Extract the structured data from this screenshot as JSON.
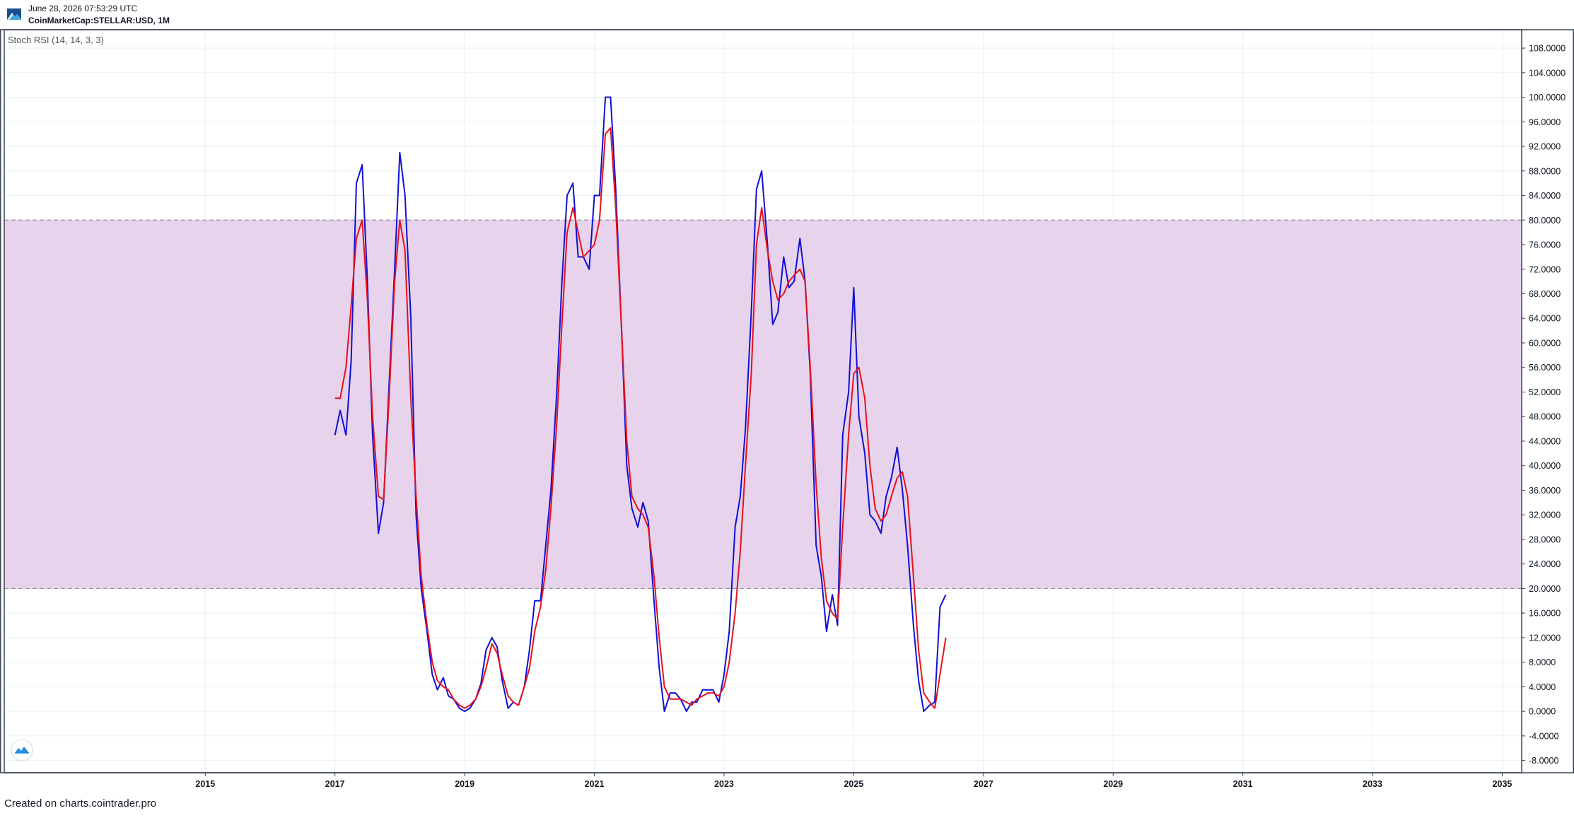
{
  "header": {
    "date": "June 28, 2026 07:53:29 UTC",
    "symbol": "CoinMarketCap:STELLAR:USD, 1M"
  },
  "footer": {
    "text": "Created on charts.cointrader.pro"
  },
  "colors": {
    "k_line": "#1010d8",
    "d_line": "#e8101c",
    "band_fill": "#e3cbe7",
    "band_border": "#9a8fa0",
    "grid": "#e9eff5",
    "frame": "#3b4552"
  },
  "chart_data": {
    "type": "line",
    "title": "Stoch RSI (14, 14, 3, 3)",
    "xlabel": "",
    "ylabel": "",
    "ylim": [
      -10,
      111
    ],
    "xlim": [
      2011.9,
      2035.3
    ],
    "grid": true,
    "legend": "none",
    "band": {
      "from": 20,
      "to": 80
    },
    "x_ticks": [
      "2015",
      "2017",
      "2019",
      "2021",
      "2023",
      "2025",
      "2027",
      "2029",
      "2031",
      "2033",
      "2035"
    ],
    "y_ticks": [
      "108.0000",
      "104.0000",
      "100.0000",
      "96.0000",
      "92.0000",
      "88.0000",
      "84.0000",
      "80.0000",
      "76.0000",
      "72.0000",
      "68.0000",
      "64.0000",
      "60.0000",
      "56.0000",
      "52.0000",
      "48.0000",
      "44.0000",
      "40.0000",
      "36.0000",
      "32.0000",
      "28.0000",
      "24.0000",
      "20.0000",
      "16.0000",
      "12.0000",
      "8.0000",
      "4.0000",
      "0.0000",
      "-4.0000",
      "-8.0000"
    ],
    "series": [
      {
        "values": [
          [
            2017.0,
            45
          ],
          [
            2017.08,
            49
          ],
          [
            2017.17,
            45
          ],
          [
            2017.25,
            57
          ],
          [
            2017.33,
            86
          ],
          [
            2017.42,
            89
          ],
          [
            2017.5,
            70
          ],
          [
            2017.58,
            45
          ],
          [
            2017.67,
            29
          ],
          [
            2017.75,
            34
          ],
          [
            2017.83,
            52
          ],
          [
            2017.92,
            72
          ],
          [
            2018.0,
            91
          ],
          [
            2018.08,
            84
          ],
          [
            2018.17,
            64
          ],
          [
            2018.25,
            32
          ],
          [
            2018.33,
            20
          ],
          [
            2018.42,
            13
          ],
          [
            2018.5,
            6
          ],
          [
            2018.58,
            3.5
          ],
          [
            2018.67,
            5.5
          ],
          [
            2018.75,
            2.5
          ],
          [
            2018.83,
            2
          ],
          [
            2018.92,
            0.5
          ],
          [
            2019.0,
            0
          ],
          [
            2019.08,
            0.5
          ],
          [
            2019.17,
            2
          ],
          [
            2019.25,
            4.5
          ],
          [
            2019.33,
            10
          ],
          [
            2019.42,
            12
          ],
          [
            2019.5,
            10.5
          ],
          [
            2019.58,
            5
          ],
          [
            2019.67,
            0.5
          ],
          [
            2019.75,
            1.5
          ],
          [
            2019.83,
            1
          ],
          [
            2019.92,
            4
          ],
          [
            2020.0,
            10
          ],
          [
            2020.08,
            18
          ],
          [
            2020.17,
            18
          ],
          [
            2020.25,
            27
          ],
          [
            2020.33,
            36
          ],
          [
            2020.42,
            52
          ],
          [
            2020.5,
            70
          ],
          [
            2020.58,
            84
          ],
          [
            2020.67,
            86
          ],
          [
            2020.75,
            74
          ],
          [
            2020.83,
            74
          ],
          [
            2020.92,
            72
          ],
          [
            2021.0,
            84
          ],
          [
            2021.08,
            84
          ],
          [
            2021.17,
            100
          ],
          [
            2021.25,
            100
          ],
          [
            2021.33,
            85
          ],
          [
            2021.42,
            62
          ],
          [
            2021.5,
            40
          ],
          [
            2021.58,
            33
          ],
          [
            2021.67,
            30
          ],
          [
            2021.75,
            34
          ],
          [
            2021.83,
            31
          ],
          [
            2021.92,
            18
          ],
          [
            2022.0,
            7
          ],
          [
            2022.08,
            0
          ],
          [
            2022.17,
            3
          ],
          [
            2022.25,
            3
          ],
          [
            2022.33,
            2
          ],
          [
            2022.42,
            0
          ],
          [
            2022.5,
            1.5
          ],
          [
            2022.58,
            1.5
          ],
          [
            2022.67,
            3.5
          ],
          [
            2022.75,
            3.5
          ],
          [
            2022.83,
            3.5
          ],
          [
            2022.92,
            1.5
          ],
          [
            2023.0,
            6
          ],
          [
            2023.08,
            13
          ],
          [
            2023.17,
            30
          ],
          [
            2023.25,
            35
          ],
          [
            2023.33,
            46
          ],
          [
            2023.42,
            65
          ],
          [
            2023.5,
            85
          ],
          [
            2023.58,
            88
          ],
          [
            2023.67,
            76
          ],
          [
            2023.75,
            63
          ],
          [
            2023.83,
            65
          ],
          [
            2023.92,
            74
          ],
          [
            2024.0,
            69
          ],
          [
            2024.08,
            70
          ],
          [
            2024.17,
            77
          ],
          [
            2024.25,
            70
          ],
          [
            2024.33,
            55
          ],
          [
            2024.42,
            27
          ],
          [
            2024.5,
            22
          ],
          [
            2024.58,
            13
          ],
          [
            2024.67,
            19
          ],
          [
            2024.75,
            14
          ],
          [
            2024.83,
            45
          ],
          [
            2024.92,
            52
          ],
          [
            2025.0,
            69
          ],
          [
            2025.08,
            48
          ],
          [
            2025.17,
            42
          ],
          [
            2025.25,
            32
          ],
          [
            2025.33,
            31
          ],
          [
            2025.42,
            29
          ],
          [
            2025.5,
            35
          ],
          [
            2025.58,
            38
          ],
          [
            2025.67,
            43
          ],
          [
            2025.75,
            36
          ],
          [
            2025.83,
            27
          ],
          [
            2025.92,
            14
          ],
          [
            2026.0,
            5
          ],
          [
            2026.08,
            0
          ],
          [
            2026.17,
            1
          ],
          [
            2026.25,
            1.5
          ],
          [
            2026.33,
            17
          ],
          [
            2026.42,
            19
          ]
        ]
      },
      {
        "values": [
          [
            2017.0,
            51
          ],
          [
            2017.08,
            51
          ],
          [
            2017.17,
            56
          ],
          [
            2017.25,
            66
          ],
          [
            2017.33,
            77
          ],
          [
            2017.42,
            80
          ],
          [
            2017.5,
            67
          ],
          [
            2017.58,
            48
          ],
          [
            2017.67,
            35
          ],
          [
            2017.75,
            34.5
          ],
          [
            2017.83,
            50
          ],
          [
            2017.92,
            70
          ],
          [
            2018.0,
            80
          ],
          [
            2018.08,
            75
          ],
          [
            2018.17,
            51
          ],
          [
            2018.25,
            35
          ],
          [
            2018.33,
            22
          ],
          [
            2018.42,
            14
          ],
          [
            2018.5,
            8
          ],
          [
            2018.58,
            5
          ],
          [
            2018.67,
            4
          ],
          [
            2018.75,
            3.5
          ],
          [
            2018.83,
            2
          ],
          [
            2018.92,
            1
          ],
          [
            2019.0,
            0.5
          ],
          [
            2019.08,
            1
          ],
          [
            2019.17,
            2
          ],
          [
            2019.25,
            4
          ],
          [
            2019.33,
            7
          ],
          [
            2019.42,
            11
          ],
          [
            2019.5,
            9.5
          ],
          [
            2019.58,
            6
          ],
          [
            2019.67,
            2.5
          ],
          [
            2019.75,
            1.5
          ],
          [
            2019.83,
            1
          ],
          [
            2019.92,
            4
          ],
          [
            2020.0,
            7
          ],
          [
            2020.08,
            13
          ],
          [
            2020.17,
            17
          ],
          [
            2020.25,
            23
          ],
          [
            2020.33,
            33
          ],
          [
            2020.42,
            47
          ],
          [
            2020.5,
            63
          ],
          [
            2020.58,
            78
          ],
          [
            2020.67,
            82
          ],
          [
            2020.75,
            78
          ],
          [
            2020.83,
            74
          ],
          [
            2020.92,
            75
          ],
          [
            2021.0,
            76
          ],
          [
            2021.08,
            80
          ],
          [
            2021.17,
            94
          ],
          [
            2021.25,
            95
          ],
          [
            2021.33,
            82
          ],
          [
            2021.42,
            62
          ],
          [
            2021.5,
            44
          ],
          [
            2021.58,
            35
          ],
          [
            2021.67,
            33
          ],
          [
            2021.75,
            32
          ],
          [
            2021.83,
            30
          ],
          [
            2021.92,
            22
          ],
          [
            2022.0,
            12
          ],
          [
            2022.08,
            4
          ],
          [
            2022.17,
            2
          ],
          [
            2022.25,
            2
          ],
          [
            2022.33,
            2
          ],
          [
            2022.42,
            1.5
          ],
          [
            2022.5,
            1
          ],
          [
            2022.58,
            2
          ],
          [
            2022.67,
            2.5
          ],
          [
            2022.75,
            3
          ],
          [
            2022.83,
            3
          ],
          [
            2022.92,
            2.5
          ],
          [
            2023.0,
            4
          ],
          [
            2023.08,
            8
          ],
          [
            2023.17,
            16
          ],
          [
            2023.25,
            26
          ],
          [
            2023.33,
            40
          ],
          [
            2023.42,
            55
          ],
          [
            2023.5,
            76
          ],
          [
            2023.58,
            82
          ],
          [
            2023.67,
            75
          ],
          [
            2023.75,
            70
          ],
          [
            2023.83,
            67
          ],
          [
            2023.92,
            68
          ],
          [
            2024.0,
            70
          ],
          [
            2024.08,
            71
          ],
          [
            2024.17,
            72
          ],
          [
            2024.25,
            70
          ],
          [
            2024.33,
            56
          ],
          [
            2024.42,
            37
          ],
          [
            2024.5,
            25
          ],
          [
            2024.58,
            18
          ],
          [
            2024.67,
            16
          ],
          [
            2024.75,
            15
          ],
          [
            2024.83,
            30
          ],
          [
            2024.92,
            45
          ],
          [
            2025.0,
            55
          ],
          [
            2025.08,
            56
          ],
          [
            2025.17,
            51
          ],
          [
            2025.25,
            40
          ],
          [
            2025.33,
            33
          ],
          [
            2025.42,
            31
          ],
          [
            2025.5,
            32
          ],
          [
            2025.58,
            35
          ],
          [
            2025.67,
            38
          ],
          [
            2025.75,
            39
          ],
          [
            2025.83,
            35
          ],
          [
            2025.92,
            22
          ],
          [
            2026.0,
            10
          ],
          [
            2026.08,
            3
          ],
          [
            2026.17,
            1.5
          ],
          [
            2026.25,
            0.5
          ],
          [
            2026.33,
            6
          ],
          [
            2026.42,
            12
          ]
        ]
      }
    ]
  }
}
